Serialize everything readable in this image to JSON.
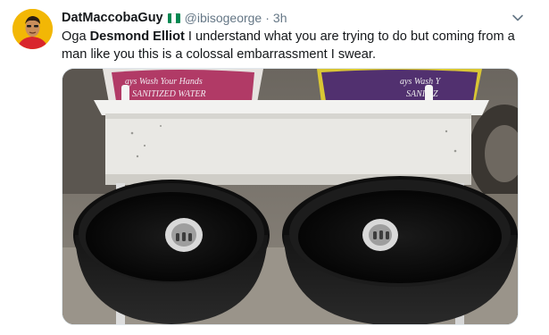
{
  "tweet": {
    "author_name": "DatMaccobaGuy",
    "handle": "@ibisogeorge",
    "separator": "·",
    "time": "3h",
    "text_before": "Oga ",
    "text_bold": "Desmond Elliot",
    "text_after": " I understand what you are trying to do but coming from a man like you this is a colossal embarrassment I swear.",
    "flag_colors": [
      "#008751",
      "#ffffff",
      "#008751"
    ]
  },
  "media": {
    "bucket_label_line1": "ays Wash Your Hands",
    "bucket_label_line2": "SANITIZED WATER",
    "bucket_label_right_line1": "ays Wash Y",
    "bucket_label_right_line2": "SANITIZ"
  },
  "icons": {
    "menu": "chevron-down-icon"
  }
}
